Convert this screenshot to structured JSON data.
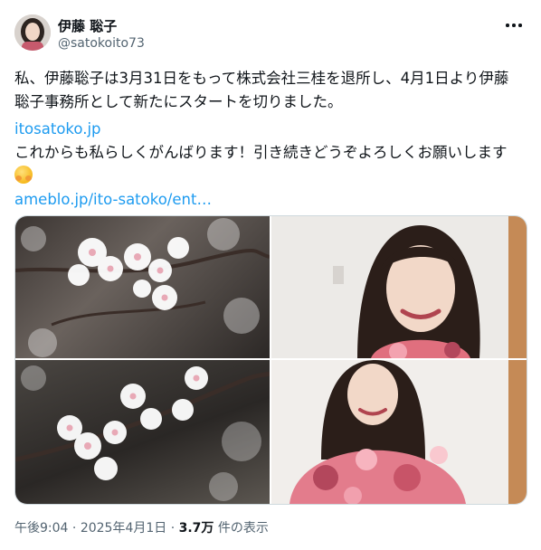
{
  "author": {
    "name": "伊藤 聡子",
    "handle": "@satokoito73"
  },
  "post": {
    "line1": "私、伊藤聡子は3月31日をもって株式会社三桂を退所し、4月1日より伊藤",
    "line2": "聡子事務所として新たにスタートを切りました。",
    "link1": "itosatoko.jp",
    "line3": "これからも私らしくがんばります！引き続きどうぞよろしくお願いします",
    "link2": "ameblo.jp/ito-satoko/ent…"
  },
  "meta": {
    "time": "午後9:04",
    "sep1": " · ",
    "date": "2025年4月1日",
    "sep2": " · ",
    "views": "3.7万",
    "views_suffix": " 件の表示"
  },
  "icons": {
    "more": "more-horizontal-icon",
    "emoji": "hugging-face-emoji"
  }
}
